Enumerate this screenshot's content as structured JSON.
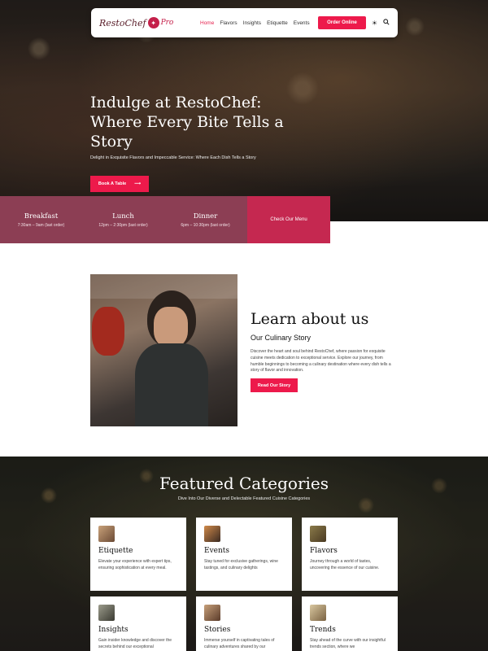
{
  "nav": {
    "logo_main": "RestoChef",
    "logo_pro": "Pro",
    "links": [
      "Home",
      "Flavors",
      "Insights",
      "Etiquette",
      "Events"
    ],
    "order_button": "Order Online"
  },
  "hero": {
    "title": "Indulge at RestoChef: Where Every Bite Tells a Story",
    "subtitle": "Delight in Exquisite Flavors and Impeccable Service: Where Each Dish Tells a Story",
    "button": "Book A Table"
  },
  "hours": {
    "items": [
      {
        "title": "Breakfast",
        "time": "7:30am – 9am (last order)"
      },
      {
        "title": "Lunch",
        "time": "12pm – 2:30pm (last order)"
      },
      {
        "title": "Dinner",
        "time": "6pm – 10:30pm (last order)"
      }
    ],
    "menu_button": "Check Our Menu"
  },
  "about": {
    "title": "Learn about us",
    "subtitle": "Our Culinary Story",
    "text": "Discover the heart and soul behind RestoChef, where passion for exquisite cuisine meets dedication to exceptional service. Explore our journey, from humble beginnings to becoming a culinary destination where every dish tells a story of flavor and innovation.",
    "button": "Read Our Story"
  },
  "categories": {
    "title": "Featured Categories",
    "subtitle": "Dive Into Our Diverse and Delectable Featured Cuisine Categories",
    "cards": [
      {
        "title": "Etiquette",
        "text": "Elevate your experience with expert tips, ensuring sophistication at every meal.",
        "icon": "dining-table-icon"
      },
      {
        "title": "Events",
        "text": "Stay tuned for exclusive gatherings, wine tastings, and culinary delights",
        "icon": "event-icon"
      },
      {
        "title": "Flavors",
        "text": "Journey through a world of tastes, uncovering the essence of our cuisine.",
        "icon": "flavors-icon"
      },
      {
        "title": "Insights",
        "text": "Gain insider knowledge and discover the secrets behind our exceptional",
        "icon": "insights-icon"
      },
      {
        "title": "Stories",
        "text": "Immerse yourself in captivating tales of culinary adventures shared by our",
        "icon": "stories-icon"
      },
      {
        "title": "Trends",
        "text": "Stay ahead of the curve with our insightful trends section, where we",
        "icon": "trends-icon"
      }
    ]
  },
  "colors": {
    "accent": "#ed1a4b",
    "hours_bg": "#8c3e54",
    "menu_button_bg": "#c52850"
  }
}
